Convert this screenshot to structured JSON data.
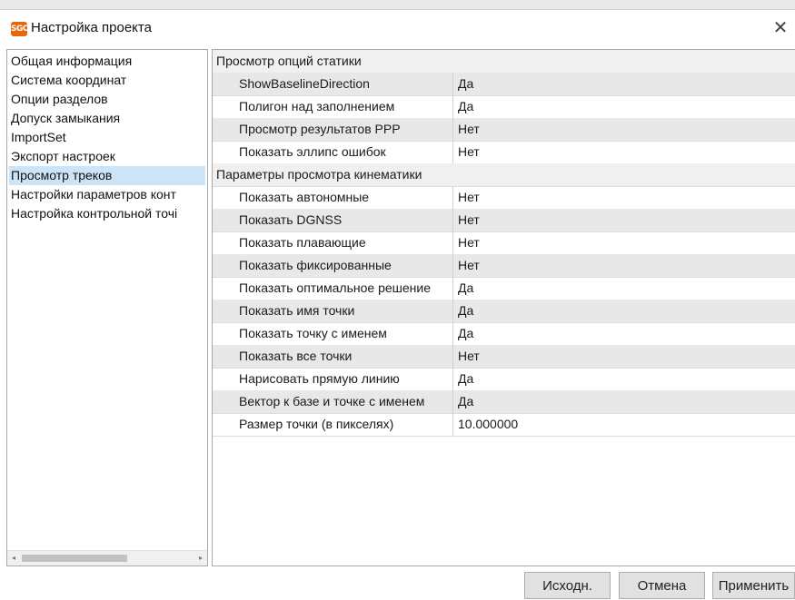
{
  "window": {
    "icon_text": "SGO",
    "title": "Настройка проекта",
    "close_glyph": "✕"
  },
  "tree": {
    "items": [
      {
        "label": "Общая информация",
        "selected": false
      },
      {
        "label": "Система координат",
        "selected": false
      },
      {
        "label": "Опции разделов",
        "selected": false
      },
      {
        "label": "Допуск замыкания",
        "selected": false
      },
      {
        "label": "ImportSet",
        "selected": false
      },
      {
        "label": "Экспорт настроек",
        "selected": false
      },
      {
        "label": "Просмотр треков",
        "selected": true
      },
      {
        "label": "Настройки параметров конт",
        "selected": false
      },
      {
        "label": "Настройка контрольной точі",
        "selected": false
      }
    ],
    "scroll_left_glyph": "◂",
    "scroll_right_glyph": "▸"
  },
  "grid": {
    "rows": [
      {
        "type": "group",
        "label": "Просмотр опций статики"
      },
      {
        "type": "prop",
        "name": "ShowBaselineDirection",
        "value": "Да",
        "alt": true
      },
      {
        "type": "prop",
        "name": "Полигон над заполнением",
        "value": "Да",
        "alt": false
      },
      {
        "type": "prop",
        "name": "Просмотр результатов PPP",
        "value": "Нет",
        "alt": true
      },
      {
        "type": "prop",
        "name": "Показать эллипс ошибок",
        "value": "Нет",
        "alt": false
      },
      {
        "type": "group",
        "label": "Параметры просмотра кинематики"
      },
      {
        "type": "prop",
        "name": "Показать автономные",
        "value": "Нет",
        "alt": false
      },
      {
        "type": "prop",
        "name": "Показать DGNSS",
        "value": "Нет",
        "alt": true
      },
      {
        "type": "prop",
        "name": "Показать плавающие",
        "value": "Нет",
        "alt": false
      },
      {
        "type": "prop",
        "name": "Показать фиксированные",
        "value": "Нет",
        "alt": true
      },
      {
        "type": "prop",
        "name": "Показать оптимальное решение",
        "value": "Да",
        "alt": false
      },
      {
        "type": "prop",
        "name": "Показать имя точки",
        "value": "Да",
        "alt": true
      },
      {
        "type": "prop",
        "name": "Показать точку с именем",
        "value": "Да",
        "alt": false
      },
      {
        "type": "prop",
        "name": "Показать все точки",
        "value": "Нет",
        "alt": true
      },
      {
        "type": "prop",
        "name": "Нарисовать прямую линию",
        "value": "Да",
        "alt": false
      },
      {
        "type": "prop",
        "name": "Вектор к базе и точке с именем",
        "value": "Да",
        "alt": true
      },
      {
        "type": "prop",
        "name": "Размер точки (в пикселях)",
        "value": "10.000000",
        "alt": false
      }
    ]
  },
  "buttons": {
    "default_label": "Исходн.",
    "cancel_label": "Отмена",
    "apply_label": "Применить"
  }
}
